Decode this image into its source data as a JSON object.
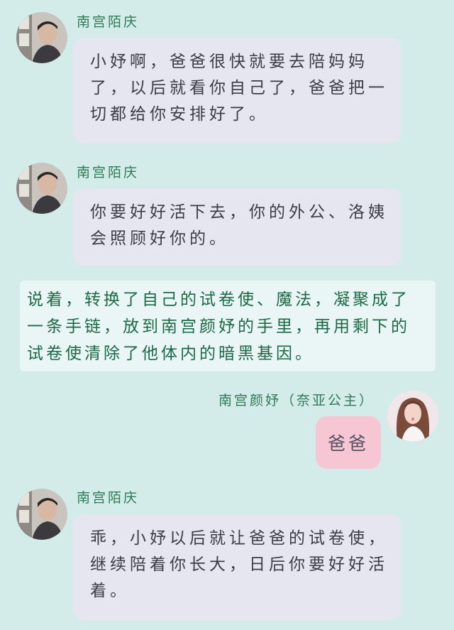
{
  "messages": [
    {
      "sender": "南宫陌庆",
      "lines": [
        "小妤啊，爸爸很快就要去陪妈妈",
        "了，以后就看你自己了，爸爸把一",
        "切都给你安排好了。"
      ]
    },
    {
      "sender": "南宫陌庆",
      "lines": [
        "你要好好活下去，你的外公、洛姨",
        "会照顾好你的。"
      ]
    },
    {
      "narration_lines": [
        "说着，转换了自己的试卷使、魔法，凝聚成了",
        "一条手链，放到南宫颜妤的手里，再用剩下的",
        "试卷使清除了他体内的暗黑基因。"
      ]
    },
    {
      "sender": "南宫颜妤（奈亚公主）",
      "text": "爸爸"
    },
    {
      "sender": "南宫陌庆",
      "lines": [
        "乖，小妤以后就让爸爸的试卷使，",
        "继续陪着你长大，日后你要好好活",
        "着。"
      ]
    }
  ],
  "colors": {
    "background": "#d3ecea",
    "name_text": "#2e7a55",
    "left_bubble": "#e5e6ef",
    "narration_bg": "#eaf5f5",
    "narration_text": "#1b6a45",
    "right_bubble": "#f7c6d4"
  }
}
